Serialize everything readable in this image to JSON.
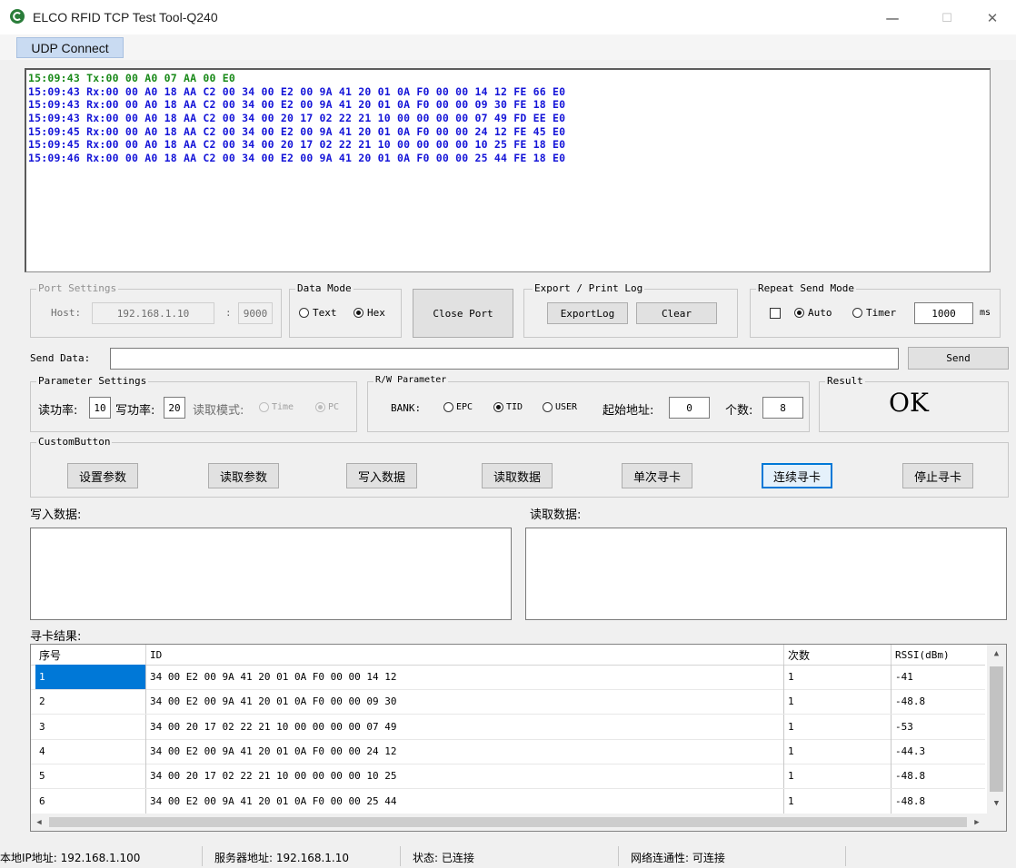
{
  "window": {
    "title": "ELCO RFID TCP Test Tool-Q240",
    "minimize": "—",
    "maximize": "☐",
    "close": "✕"
  },
  "menu": {
    "udp_connect": "UDP Connect"
  },
  "colors": {
    "tx": "#1a8a1a",
    "rx": "#1515d8",
    "selection": "#0078d7",
    "udp_bg": "#c9dbf2"
  },
  "log": [
    {
      "kind": "tx",
      "text": "15:09:43 Tx:00 00 A0 07 AA 00 E0"
    },
    {
      "kind": "rx",
      "text": "15:09:43 Rx:00 00 A0 18 AA C2 00 34 00 E2 00 9A 41 20 01 0A F0 00 00 14 12 FE 66 E0"
    },
    {
      "kind": "rx",
      "text": "15:09:43 Rx:00 00 A0 18 AA C2 00 34 00 E2 00 9A 41 20 01 0A F0 00 00 09 30 FE 18 E0"
    },
    {
      "kind": "rx",
      "text": "15:09:43 Rx:00 00 A0 18 AA C2 00 34 00 20 17 02 22 21 10 00 00 00 00 07 49 FD EE E0"
    },
    {
      "kind": "rx",
      "text": "15:09:45 Rx:00 00 A0 18 AA C2 00 34 00 E2 00 9A 41 20 01 0A F0 00 00 24 12 FE 45 E0"
    },
    {
      "kind": "rx",
      "text": "15:09:45 Rx:00 00 A0 18 AA C2 00 34 00 20 17 02 22 21 10 00 00 00 00 10 25 FE 18 E0"
    },
    {
      "kind": "rx",
      "text": "15:09:46 Rx:00 00 A0 18 AA C2 00 34 00 E2 00 9A 41 20 01 0A F0 00 00 25 44 FE 18 E0"
    }
  ],
  "port": {
    "group": "Port Settings",
    "host_label": "Host:",
    "host": "192.168.1.10",
    "colon": ":",
    "port": "9000"
  },
  "data_mode": {
    "group": "Data Mode",
    "text": "Text",
    "hex": "Hex",
    "selected": "Hex"
  },
  "close_port": "Close Port",
  "export": {
    "group": "Export / Print Log",
    "export_btn": "ExportLog",
    "clear_btn": "Clear"
  },
  "repeat": {
    "group": "Repeat Send Mode",
    "auto": "Auto",
    "timer": "Timer",
    "selected": "Auto",
    "interval": "1000",
    "unit": "ms"
  },
  "send": {
    "label": "Send Data:",
    "value": "",
    "button": "Send"
  },
  "params": {
    "group": "Parameter Settings",
    "read_power_label": "读功率:",
    "read_power": "10",
    "write_power_label": "写功率:",
    "write_power": "20",
    "read_mode_label": "读取模式:",
    "mode_time": "Time",
    "mode_pc": "PC",
    "selected_mode": "PC"
  },
  "rw": {
    "group": "R/W Parameter",
    "bank_label": "BANK:",
    "epc": "EPC",
    "tid": "TID",
    "user": "USER",
    "selected_bank": "TID",
    "start_label": "起始地址:",
    "start": "0",
    "count_label": "个数:",
    "count": "8"
  },
  "result": {
    "group": "Result",
    "value": "OK"
  },
  "custom": {
    "group": "CustomButton",
    "buttons": [
      "设置参数",
      "读取参数",
      "写入数据",
      "读取数据",
      "单次寻卡",
      "连续寻卡",
      "停止寻卡"
    ],
    "focused": "连续寻卡"
  },
  "write_data": {
    "label": "写入数据:",
    "value": ""
  },
  "read_data": {
    "label": "读取数据:",
    "value": ""
  },
  "cards": {
    "label": "寻卡结果:",
    "headers": [
      "序号",
      "ID",
      "次数",
      "RSSI(dBm)"
    ],
    "rows": [
      [
        "1",
        "34 00 E2 00 9A 41 20 01 0A F0 00 00 14 12",
        "1",
        "-41"
      ],
      [
        "2",
        "34 00 E2 00 9A 41 20 01 0A F0 00 00 09 30",
        "1",
        "-48.8"
      ],
      [
        "3",
        "34 00 20 17 02 22 21 10 00 00 00 00 07 49",
        "1",
        "-53"
      ],
      [
        "4",
        "34 00 E2 00 9A 41 20 01 0A F0 00 00 24 12",
        "1",
        "-44.3"
      ],
      [
        "5",
        "34 00 20 17 02 22 21 10 00 00 00 00 10 25",
        "1",
        "-48.8"
      ],
      [
        "6",
        "34 00 E2 00 9A 41 20 01 0A F0 00 00 25 44",
        "1",
        "-48.8"
      ]
    ]
  },
  "statusbar": {
    "local_ip": "本地IP地址: 192.168.1.100",
    "server": "服务器地址: 192.168.1.10",
    "state": "状态: 已连接",
    "network": "网络连通性: 可连接"
  }
}
